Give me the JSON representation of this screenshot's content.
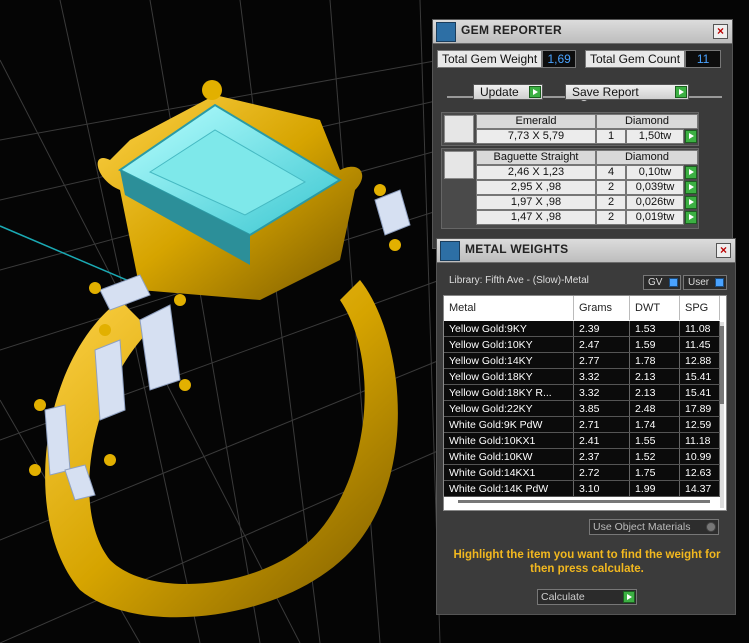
{
  "gem_reporter": {
    "title": "GEM REPORTER",
    "total_weight_label": "Total Gem Weight",
    "total_weight_value": "1,69",
    "total_count_label": "Total Gem Count",
    "total_count_value": "11",
    "update_label": "Update",
    "save_report_label": "Save Report",
    "groups": [
      {
        "shape": "Emerald",
        "material": "Diamond",
        "rows": [
          {
            "size": "7,73 X 5,79",
            "count": "1",
            "weight": "1,50tw"
          }
        ]
      },
      {
        "shape": "Baguette Straight",
        "material": "Diamond",
        "rows": [
          {
            "size": "2,46 X 1,23",
            "count": "4",
            "weight": "0,10tw"
          },
          {
            "size": "2,95 X ,98",
            "count": "2",
            "weight": "0,039tw"
          },
          {
            "size": "1,97 X ,98",
            "count": "2",
            "weight": "0,026tw"
          },
          {
            "size": "1,47 X ,98",
            "count": "2",
            "weight": "0,019tw"
          }
        ]
      }
    ]
  },
  "metal_weights": {
    "title": "METAL WEIGHTS",
    "library": "Library: Fifth Ave - (Slow)-Metal",
    "gv_label": "GV",
    "user_label": "User",
    "columns": [
      "Metal",
      "Grams",
      "DWT",
      "SPG"
    ],
    "rows": [
      [
        "Yellow Gold:9KY",
        "2.39",
        "1.53",
        "11.08"
      ],
      [
        "Yellow Gold:10KY",
        "2.47",
        "1.59",
        "11.45"
      ],
      [
        "Yellow Gold:14KY",
        "2.77",
        "1.78",
        "12.88"
      ],
      [
        "Yellow Gold:18KY",
        "3.32",
        "2.13",
        "15.41"
      ],
      [
        "Yellow Gold:18KY R...",
        "3.32",
        "2.13",
        "15.41"
      ],
      [
        "Yellow Gold:22KY",
        "3.85",
        "2.48",
        "17.89"
      ],
      [
        "White Gold:9K PdW",
        "2.71",
        "1.74",
        "12.59"
      ],
      [
        "White Gold:10KX1",
        "2.41",
        "1.55",
        "11.18"
      ],
      [
        "White Gold:10KW",
        "2.37",
        "1.52",
        "10.99"
      ],
      [
        "White Gold:14KX1",
        "2.72",
        "1.75",
        "12.63"
      ],
      [
        "White Gold:14K PdW",
        "3.10",
        "1.99",
        "14.37"
      ]
    ],
    "use_object_materials": "Use Object Materials",
    "hint": "Highlight the item you want to find the weight for then press calculate.",
    "calculate_label": "Calculate"
  },
  "colors": {
    "gold": "#d6a400",
    "gem": "#6fe0e0",
    "hint": "#f2b81f",
    "accent_blue": "#4aa3ff",
    "go_green": "#3cb043"
  }
}
